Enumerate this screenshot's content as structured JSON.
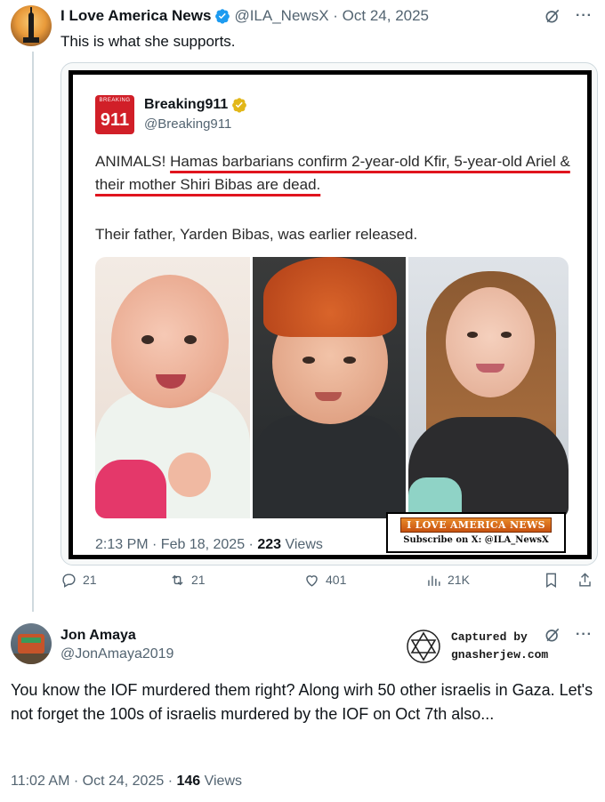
{
  "post1": {
    "author_name": "I Love America News",
    "handle": "@ILA_NewsX",
    "separator": "·",
    "date": "Oct 24, 2025",
    "text": "This is what she supports.",
    "embedded": {
      "avatar_tiny": "BREAKING",
      "avatar_text": "911",
      "author_name": "Breaking911",
      "handle": "@Breaking911",
      "text_prefix": "ANIMALS! ",
      "text_underlined": "Hamas barbarians confirm 2-year-old Kfir, 5-year-old Ariel & their mother Shiri Bibas are dead.",
      "text2": "Their father, Yarden Bibas, was earlier released.",
      "timestamp": "2:13 PM · Feb 18, 2025 · ",
      "views_count": "223",
      "views_label": " Views",
      "watermark_logo": "I LOVE AMERICA NEWS",
      "watermark_sub": "Subscribe on X: @ILA_NewsX"
    },
    "actions": {
      "replies": "21",
      "reposts": "21",
      "likes": "401",
      "views": "21K"
    }
  },
  "post2": {
    "author_name": "Jon Amaya",
    "handle": "@JonAmaya2019",
    "capture_line1": "Captured by",
    "capture_line2": "gnasherjew.com",
    "text": "You know the IOF murdered them right? Along wirh 50 other israelis in Gaza. Let's not forget the 100s of israelis murdered by the IOF on Oct 7th also...",
    "timestamp": "11:02 AM · Oct 24, 2025 · ",
    "views_count": "146",
    "views_label": " Views"
  },
  "colors": {
    "verified_gold": "#e2b719",
    "verified_blue": "#1d9bf0",
    "underline_red": "#e0141e",
    "secondary_text": "#536471"
  },
  "icons": [
    "grok-icon",
    "more-icon",
    "reply-icon",
    "repost-icon",
    "like-icon",
    "views-icon",
    "bookmark-icon",
    "share-icon",
    "verified-badge-icon",
    "star-of-david-icon"
  ]
}
